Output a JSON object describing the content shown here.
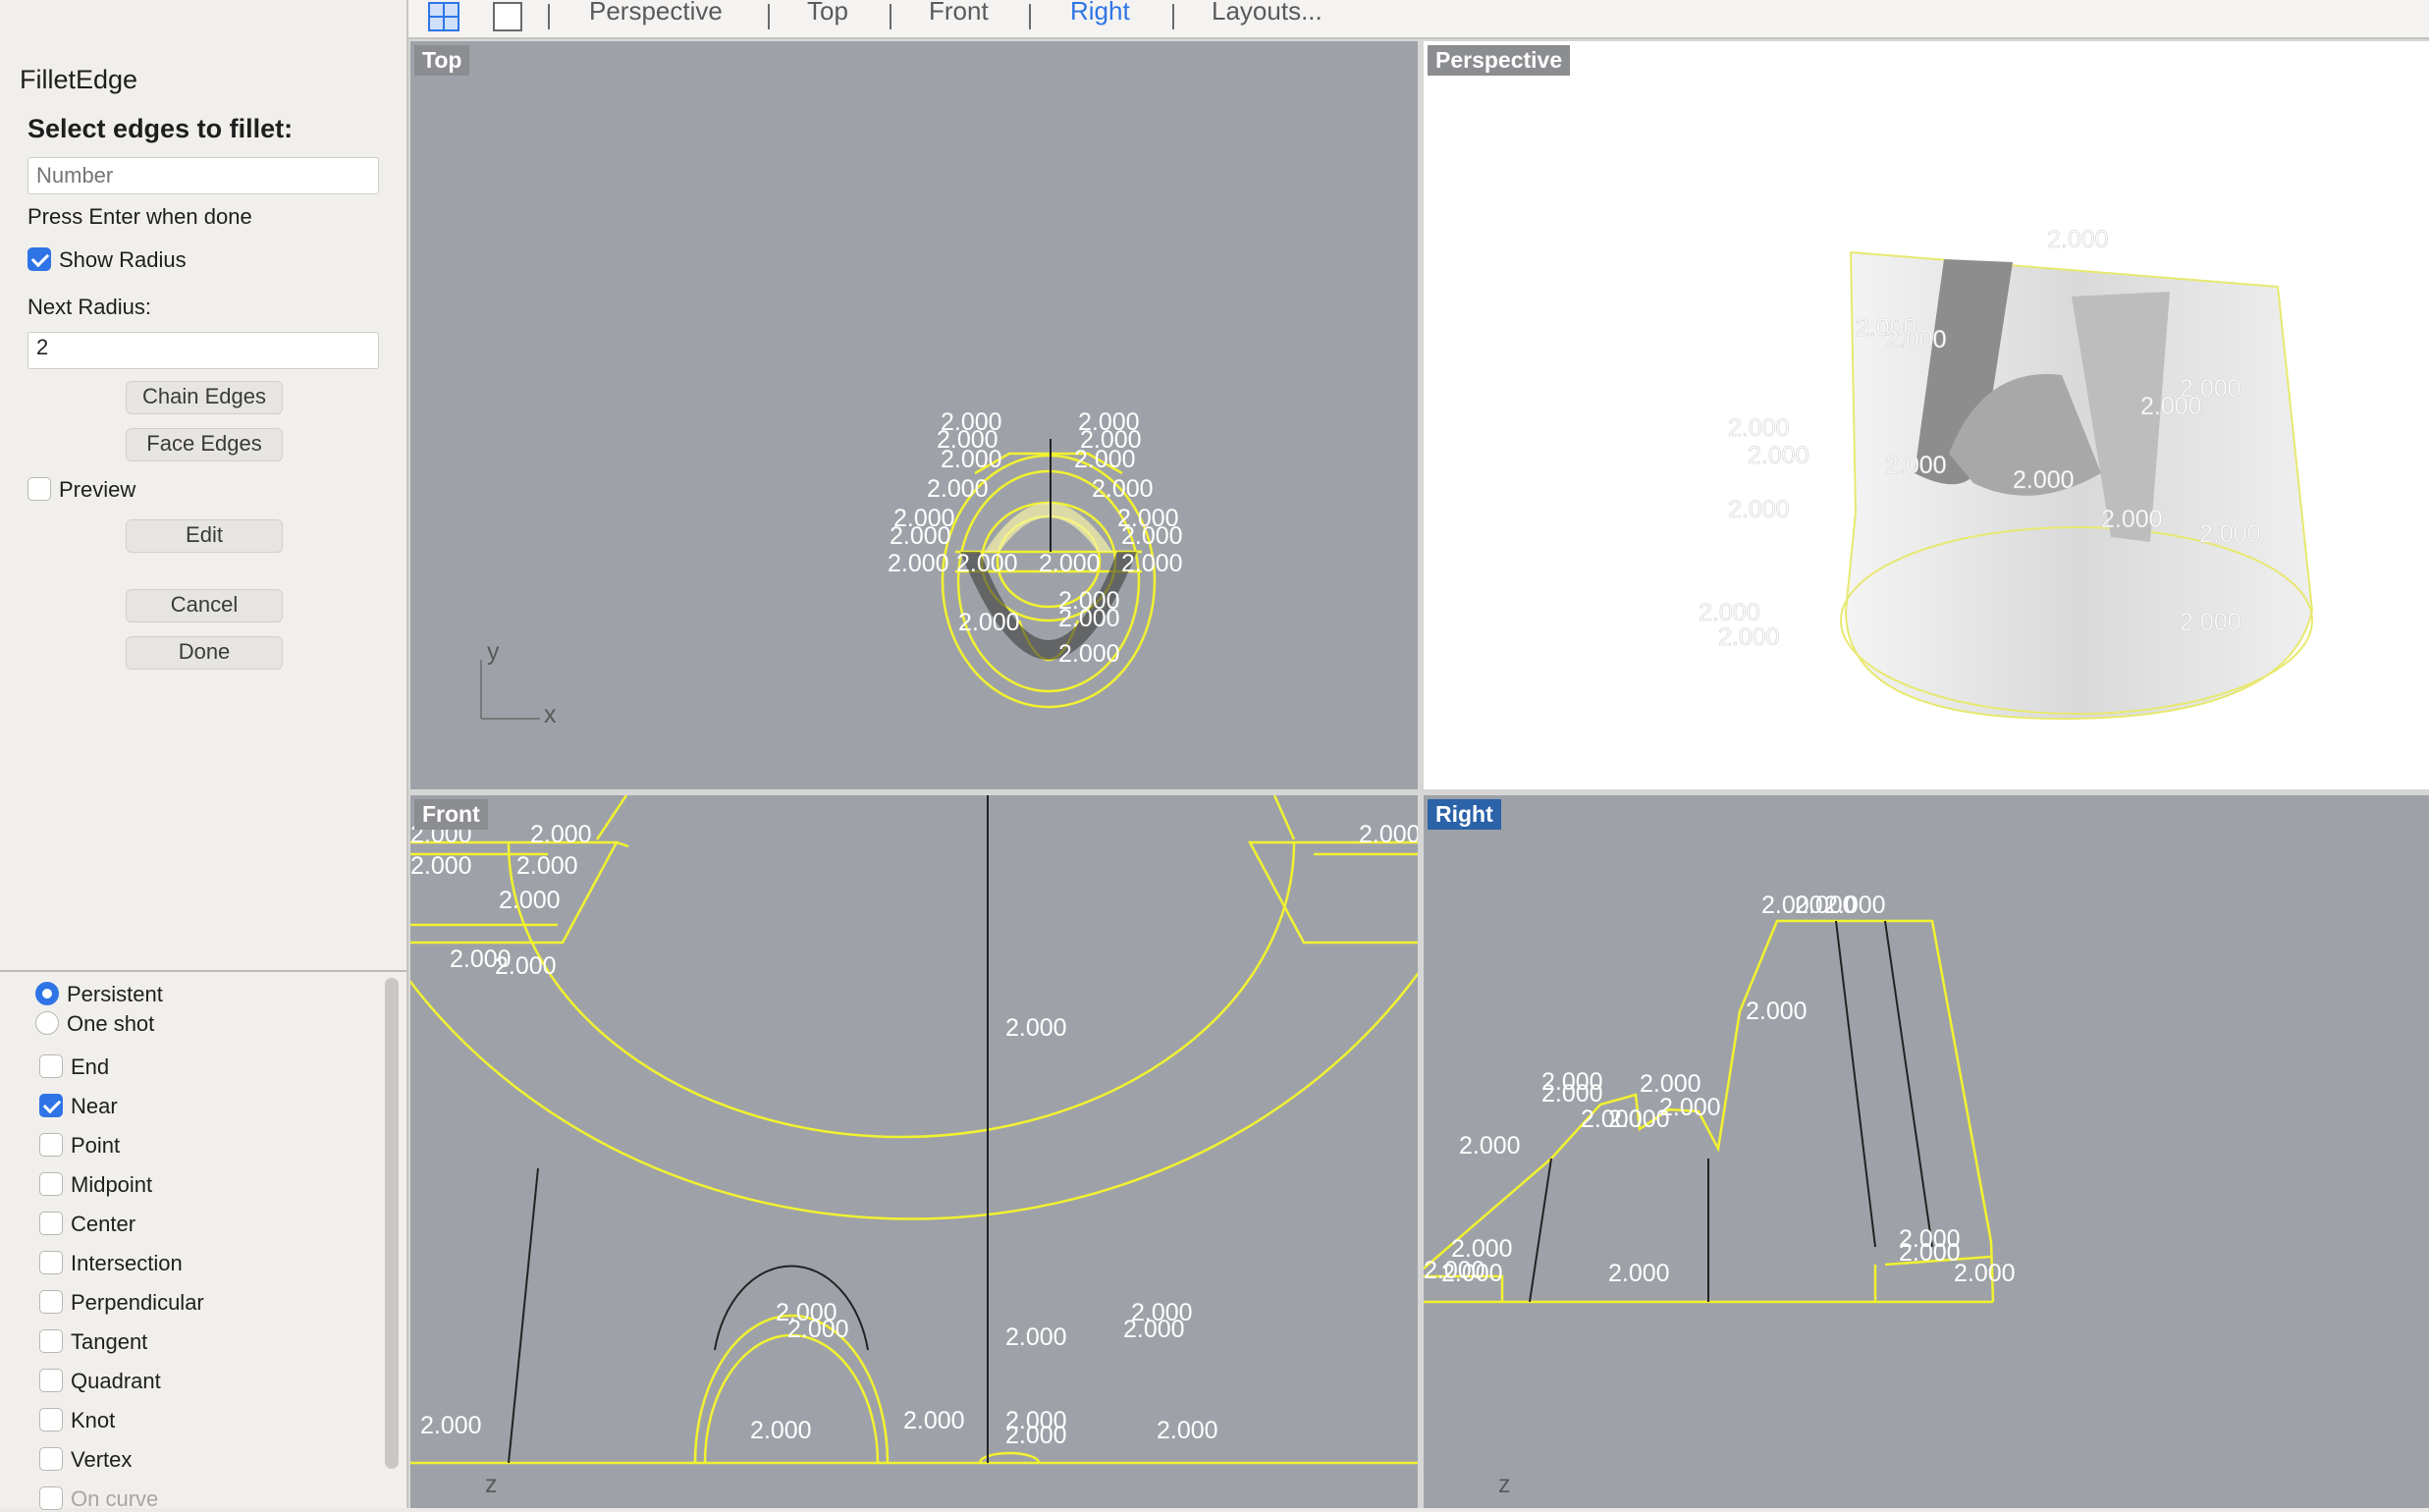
{
  "command": {
    "title": "FilletEdge",
    "prompt": "Select edges to fillet:",
    "number_placeholder": "Number",
    "hint": "Press Enter when done",
    "show_radius_label": "Show Radius",
    "show_radius_checked": true,
    "next_radius_label": "Next Radius:",
    "next_radius_value": "2",
    "chain_edges": "Chain Edges",
    "face_edges": "Face Edges",
    "preview_label": "Preview",
    "preview_checked": false,
    "edit": "Edit",
    "cancel": "Cancel",
    "done": "Done"
  },
  "osnap": {
    "persistent": "Persistent",
    "one_shot": "One shot",
    "mode_selected": "Persistent",
    "items": [
      {
        "label": "End",
        "checked": false
      },
      {
        "label": "Near",
        "checked": true
      },
      {
        "label": "Point",
        "checked": false
      },
      {
        "label": "Midpoint",
        "checked": false
      },
      {
        "label": "Center",
        "checked": false
      },
      {
        "label": "Intersection",
        "checked": false
      },
      {
        "label": "Perpendicular",
        "checked": false
      },
      {
        "label": "Tangent",
        "checked": false
      },
      {
        "label": "Quadrant",
        "checked": false
      },
      {
        "label": "Knot",
        "checked": false
      },
      {
        "label": "Vertex",
        "checked": false
      },
      {
        "label": "On curve",
        "checked": false
      }
    ]
  },
  "tabs": {
    "perspective": "Perspective",
    "top": "Top",
    "front": "Front",
    "right": "Right",
    "layouts": "Layouts...",
    "active": "Right"
  },
  "viewports": {
    "top": "Top",
    "perspective": "Perspective",
    "front": "Front",
    "right": "Right",
    "active": "Right"
  },
  "axes": {
    "x": "x",
    "y": "y",
    "z": "z"
  },
  "dimension_text": "2.000",
  "colors": {
    "viewport_bg": "#9ea2a8",
    "perspective_bg": "#ffffff",
    "curve": "#f2f230",
    "active_accent": "#2b62a8",
    "check_blue": "#2f74e6"
  }
}
